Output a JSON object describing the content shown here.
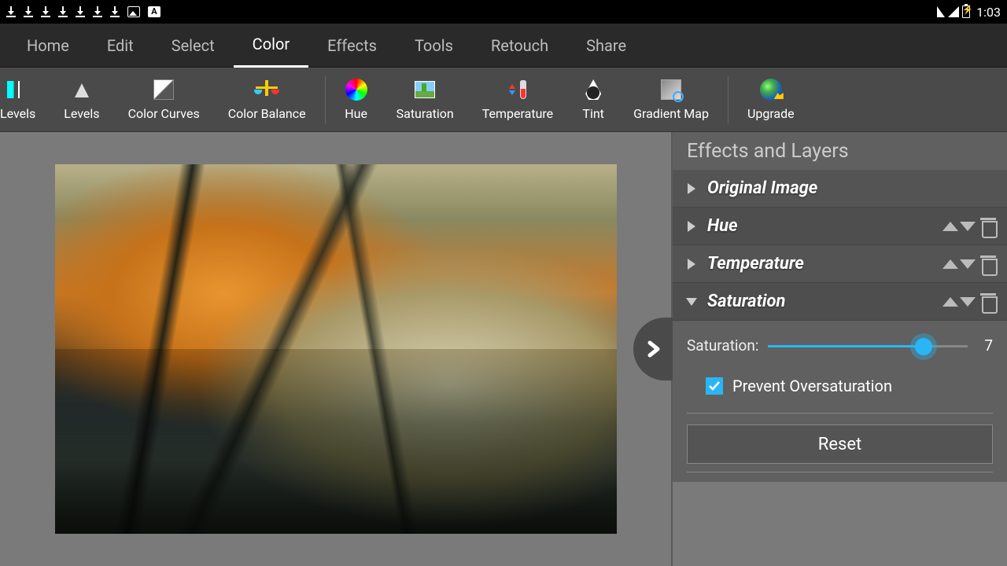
{
  "status": {
    "time": "1:03"
  },
  "menu": {
    "items": [
      {
        "label": "Home"
      },
      {
        "label": "Edit"
      },
      {
        "label": "Select"
      },
      {
        "label": "Color",
        "active": true
      },
      {
        "label": "Effects"
      },
      {
        "label": "Tools"
      },
      {
        "label": "Retouch"
      },
      {
        "label": "Share"
      }
    ]
  },
  "toolbar": {
    "items": [
      {
        "label": "Levels",
        "id": "auto-levels"
      },
      {
        "label": "Levels",
        "id": "levels"
      },
      {
        "label": "Color Curves",
        "id": "curves"
      },
      {
        "label": "Color Balance",
        "id": "balance"
      },
      {
        "label": "Hue",
        "id": "hue",
        "sepBefore": true
      },
      {
        "label": "Saturation",
        "id": "saturation"
      },
      {
        "label": "Temperature",
        "id": "temperature"
      },
      {
        "label": "Tint",
        "id": "tint"
      },
      {
        "label": "Gradient Map",
        "id": "gradmap"
      },
      {
        "label": "Upgrade",
        "id": "upgrade",
        "sepBefore": true
      }
    ]
  },
  "panel": {
    "title": "Effects and Layers",
    "layers": [
      {
        "name": "Original Image",
        "expanded": false,
        "controls": false
      },
      {
        "name": "Hue",
        "expanded": false,
        "controls": true
      },
      {
        "name": "Temperature",
        "expanded": false,
        "controls": true
      },
      {
        "name": "Saturation",
        "expanded": true,
        "controls": true
      }
    ],
    "saturation": {
      "label": "Saturation:",
      "value": "7",
      "percent": 78,
      "checkbox_label": "Prevent Oversaturation",
      "checked": true,
      "reset_label": "Reset"
    }
  }
}
